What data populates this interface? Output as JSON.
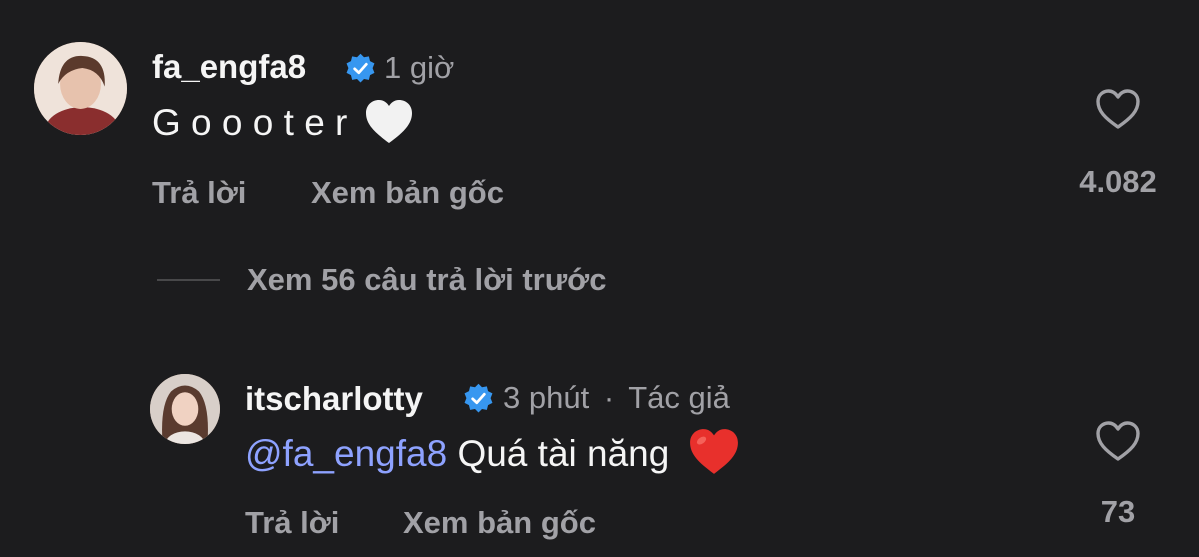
{
  "comments": [
    {
      "username": "fa_engfa8",
      "time": "1 giờ",
      "text": "G o o o t e r",
      "emoji": "white-heart",
      "reply_label": "Trả lời",
      "see_original_label": "Xem bản gốc",
      "like_count": "4.082"
    },
    {
      "username": "itscharlotty",
      "time": "3 phút",
      "separator": "·",
      "author_badge": "Tác giả",
      "mention": "@fa_engfa8",
      "text": " Quá tài năng",
      "emoji": "red-heart",
      "reply_label": "Trả lời",
      "see_original_label": "Xem bản gốc",
      "like_count": "73"
    }
  ],
  "view_previous_replies": "Xem 56 câu trả lời trước",
  "colors": {
    "background": "#1c1c1e",
    "primary_text": "#f5f5f5",
    "secondary_text": "#a1a1a6",
    "verified_blue": "#3797f0",
    "mention": "#8ea2ff",
    "red_heart": "#e8302c"
  }
}
